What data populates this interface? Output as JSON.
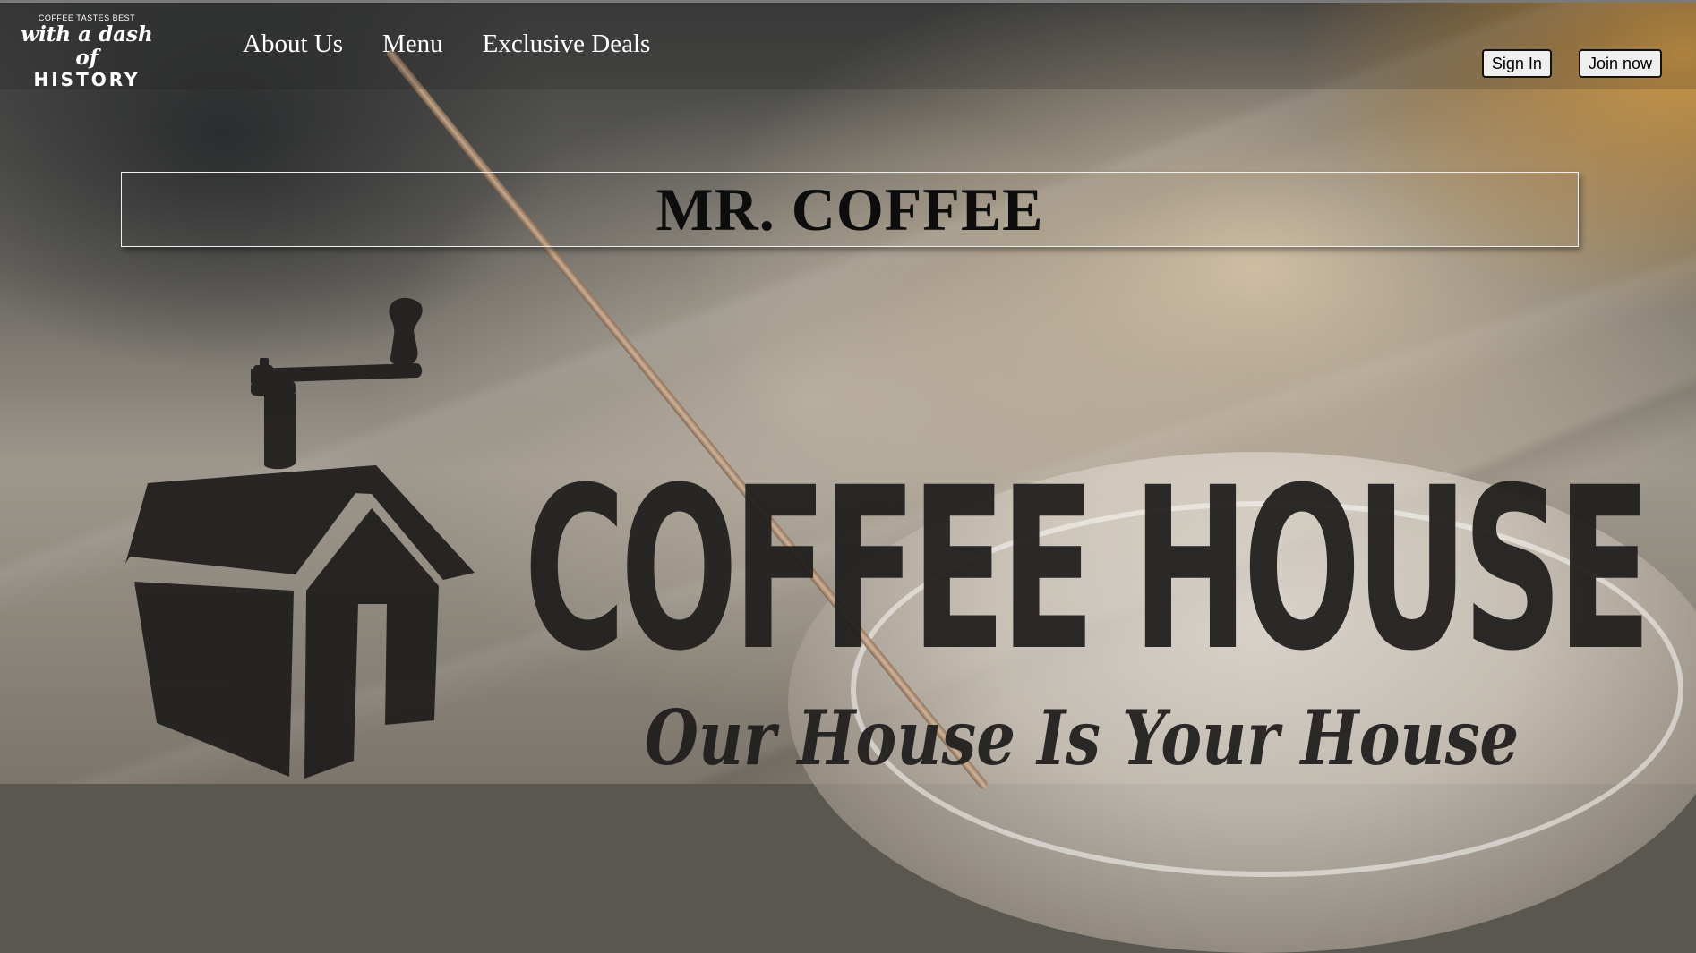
{
  "brand": {
    "tagline": "COFFEE TASTES BEST",
    "script": "with a dash of",
    "caps": "HISTORY"
  },
  "nav": {
    "items": [
      {
        "label": "About Us"
      },
      {
        "label": "Menu"
      },
      {
        "label": "Exclusive Deals"
      }
    ]
  },
  "auth": {
    "sign_in": "Sign In",
    "join_now": "Join now"
  },
  "hero": {
    "title": "MR. COFFEE",
    "logo_word": "COFFEE HOUSE",
    "logo_tagline": "Our House Is Your House",
    "logo_icon": "coffee-grinder-house-icon"
  },
  "colors": {
    "logo_dark": "#1f1d1c",
    "nav_text": "#ffffff"
  }
}
